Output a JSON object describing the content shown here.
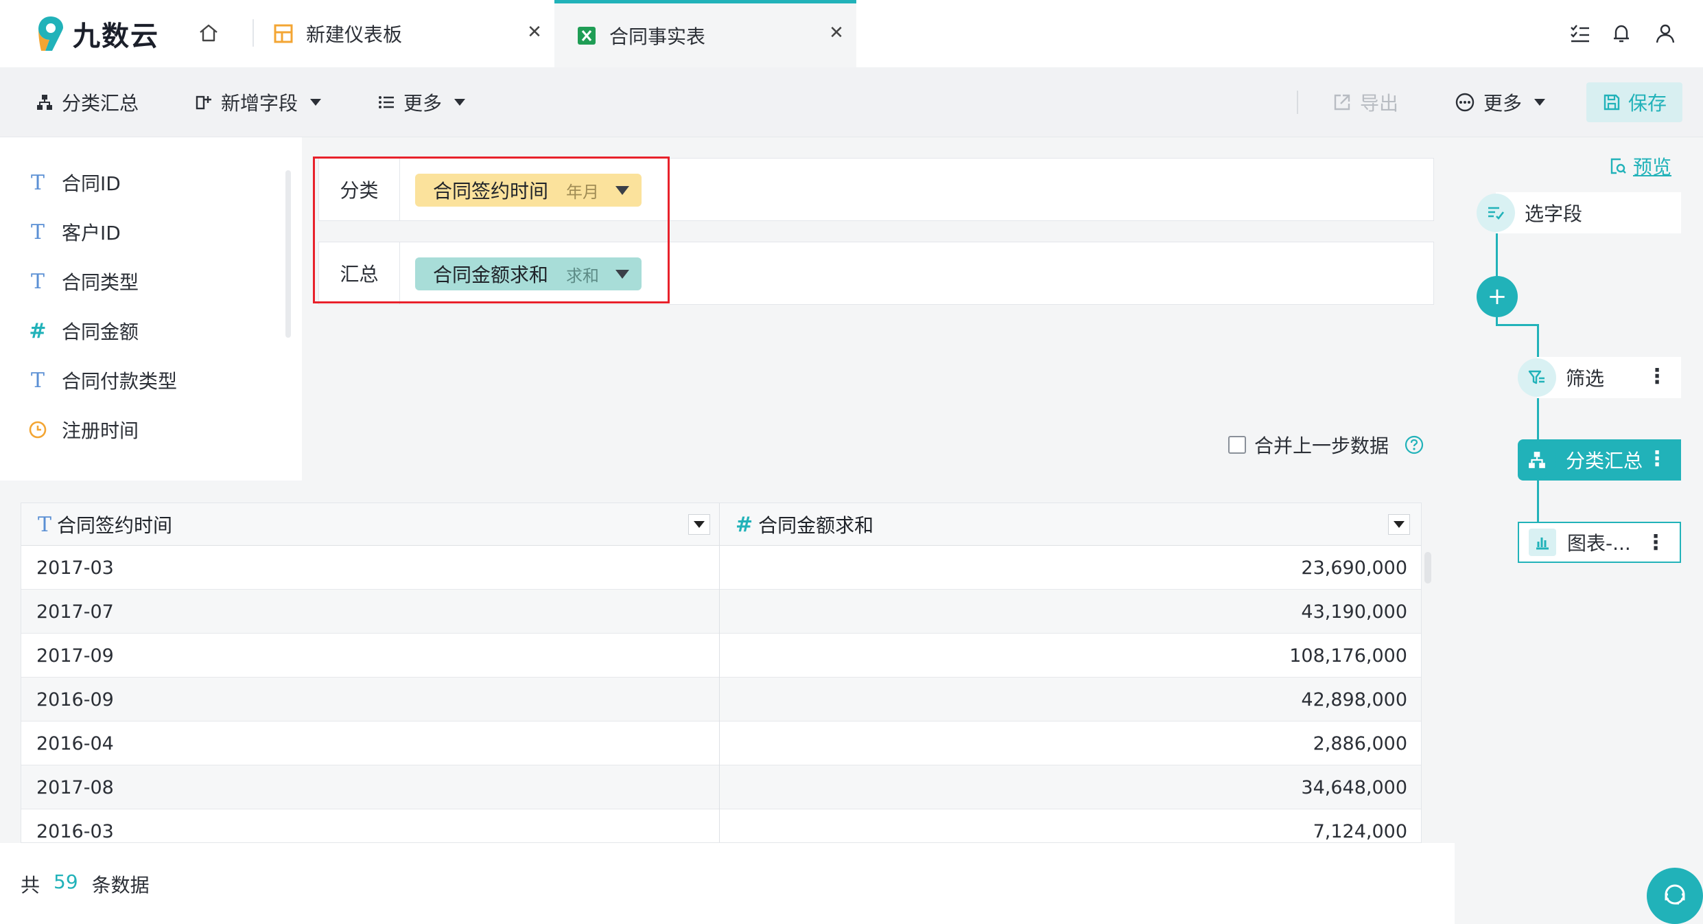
{
  "app": {
    "logo_text": "九数云"
  },
  "tabs": [
    {
      "label": "新建仪表板",
      "icon": "dashboard-icon"
    },
    {
      "label": "合同事实表",
      "icon": "excel-icon",
      "active": true
    }
  ],
  "toolbar": {
    "group_summary": "分类汇总",
    "add_field": "新增字段",
    "more_left": "更多",
    "export": "导出",
    "more_right": "更多",
    "save": "保存"
  },
  "fields": [
    {
      "type": "T",
      "name": "合同ID"
    },
    {
      "type": "T",
      "name": "客户ID"
    },
    {
      "type": "T",
      "name": "合同类型"
    },
    {
      "type": "#",
      "name": "合同金额"
    },
    {
      "type": "T",
      "name": "合同付款类型"
    },
    {
      "type": "clock",
      "name": "注册时间"
    }
  ],
  "config": {
    "category_label": "分类",
    "category_field": "合同签约时间",
    "category_sub": "年月",
    "summary_label": "汇总",
    "summary_field": "合同金额求和",
    "summary_sub": "求和",
    "merge_label": "合并上一步数据"
  },
  "table": {
    "columns": [
      {
        "type": "T",
        "label": "合同签约时间"
      },
      {
        "type": "#",
        "label": "合同金额求和"
      }
    ],
    "rows": [
      [
        "2017-03",
        "23,690,000"
      ],
      [
        "2017-07",
        "43,190,000"
      ],
      [
        "2017-09",
        "108,176,000"
      ],
      [
        "2016-09",
        "42,898,000"
      ],
      [
        "2016-04",
        "2,886,000"
      ],
      [
        "2017-08",
        "34,648,000"
      ],
      [
        "2016-03",
        "7,124,000"
      ]
    ]
  },
  "footer": {
    "prefix": "共",
    "count": "59",
    "suffix": "条数据"
  },
  "flow": {
    "preview": "预览",
    "select_fields": "选字段",
    "filter": "筛选",
    "group_summary": "分类汇总",
    "chart": "图表-..."
  },
  "colors": {
    "accent": "#21b2b9",
    "highlight": "#e8212b",
    "pill_yellow": "#fbe29c",
    "pill_green": "#a8ddd8"
  }
}
